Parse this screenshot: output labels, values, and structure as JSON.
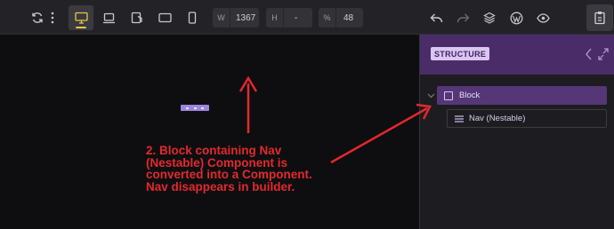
{
  "toolbar": {
    "width_label": "W",
    "width_value": "1367",
    "height_label": "H",
    "height_value": "-",
    "scale_label": "%",
    "scale_value": "48"
  },
  "structure_panel": {
    "title": "STRUCTURE",
    "items": [
      {
        "label": "Block",
        "icon": "square-icon",
        "selected": true
      },
      {
        "label": "Nav (Nestable)",
        "icon": "hamburger-icon",
        "selected": false
      }
    ]
  },
  "annotation": {
    "lines": [
      "2. Block containing Nav",
      "(Nestable) Component is",
      "converted into a Component.",
      "Nav disappears in builder."
    ],
    "color": "#e3292c"
  },
  "colors": {
    "accent": "#e8c64a",
    "panel_header": "#4a2d68",
    "selected_row": "#553777"
  }
}
